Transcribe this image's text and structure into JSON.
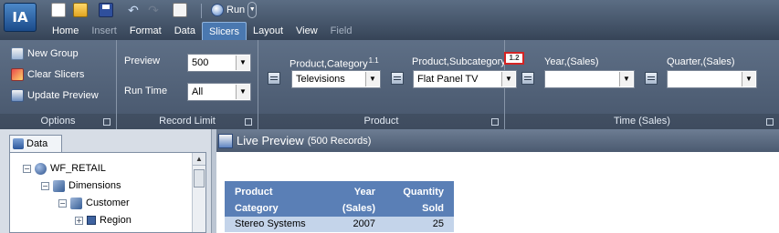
{
  "app": {
    "logo_text": "IA"
  },
  "quick_access": {
    "run_label": "Run"
  },
  "tabs": [
    {
      "label": "Home",
      "state": "normal"
    },
    {
      "label": "Insert",
      "state": "disabled"
    },
    {
      "label": "Format",
      "state": "normal"
    },
    {
      "label": "Data",
      "state": "normal"
    },
    {
      "label": "Slicers",
      "state": "active"
    },
    {
      "label": "Layout",
      "state": "normal"
    },
    {
      "label": "View",
      "state": "normal"
    },
    {
      "label": "Field",
      "state": "disabled"
    }
  ],
  "ribbon": {
    "options": {
      "items": [
        "New Group",
        "Clear Slicers",
        "Update Preview"
      ],
      "label": "Options"
    },
    "record_limit": {
      "preview_label": "Preview",
      "preview_value": "500",
      "runtime_label": "Run Time",
      "runtime_value": "All",
      "label": "Record Limit"
    },
    "product": {
      "label": "Product",
      "category_label": "Product,Category",
      "category_sup": "1.1",
      "category_value": "Televisions",
      "subcategory_label": "Product,Subcategory",
      "subcategory_badge": "1.2",
      "subcategory_value": "Flat Panel TV"
    },
    "time": {
      "label": "Time (Sales)",
      "year_label": "Year,(Sales)",
      "year_value": "",
      "quarter_label": "Quarter,(Sales)",
      "quarter_value": ""
    }
  },
  "data_panel": {
    "tab_label": "Data",
    "tree": [
      "WF_RETAIL",
      "Dimensions",
      "Customer",
      "Region"
    ]
  },
  "preview": {
    "title": "Live Preview",
    "count": "(500 Records)",
    "report": {
      "header": [
        {
          "line1": "Product",
          "line2": "Category"
        },
        {
          "line1": "Year",
          "line2": "(Sales)"
        },
        {
          "line1": "Quantity",
          "line2": "Sold"
        }
      ],
      "rows": [
        [
          "Stereo Systems",
          "2007",
          "25"
        ]
      ]
    }
  },
  "colors": {
    "ribbon": "#4f5f76",
    "active_tab": "#4a78b0",
    "report_header": "#5a7fb6",
    "report_row": "#c4d4ea",
    "badge_border": "#d42424"
  }
}
